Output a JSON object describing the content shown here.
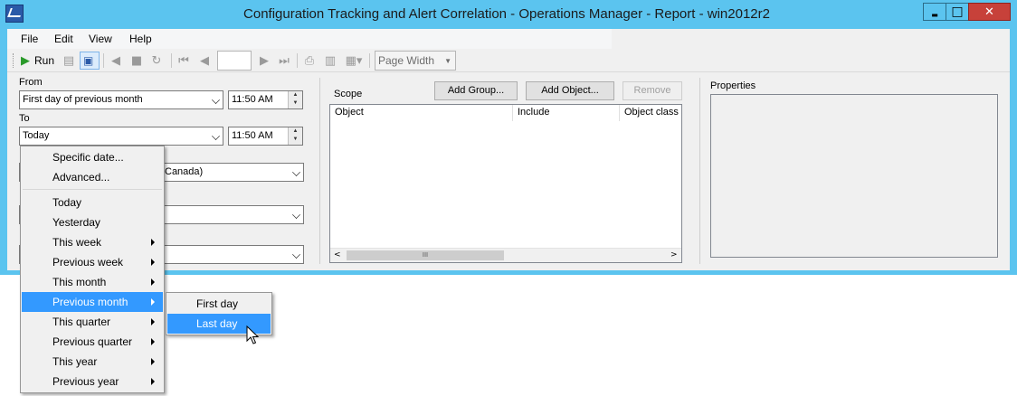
{
  "window": {
    "title": "Configuration Tracking and Alert Correlation - Operations Manager - Report - win2012r2",
    "controls": {
      "minimize": "▬",
      "maximize": "□",
      "close": "✕"
    }
  },
  "menu": {
    "items": [
      "File",
      "Edit",
      "View",
      "Help"
    ]
  },
  "toolbar": {
    "run_label": "Run",
    "zoom_value": "Page Width",
    "page_number": ""
  },
  "form": {
    "from_label": "From",
    "from_value": "First day of previous month",
    "from_time": "11:50 AM",
    "to_label": "To",
    "to_value": "Today",
    "to_time": "11:50 AM",
    "timezone_partial": "Canada)",
    "combo_a_value": "",
    "combo_b_value": ""
  },
  "scope": {
    "label": "Scope",
    "add_group": "Add Group...",
    "add_object": "Add Object...",
    "remove": "Remove",
    "columns": [
      "Object",
      "Include",
      "Object class"
    ],
    "scroll_thumb": "III"
  },
  "properties": {
    "label": "Properties"
  },
  "context_menu": {
    "items": [
      {
        "label": "Specific date...",
        "submenu": false
      },
      {
        "label": "Advanced...",
        "submenu": false
      },
      {
        "label": "Today",
        "submenu": false
      },
      {
        "label": "Yesterday",
        "submenu": false
      },
      {
        "label": "This week",
        "submenu": true
      },
      {
        "label": "Previous week",
        "submenu": true
      },
      {
        "label": "This month",
        "submenu": true
      },
      {
        "label": "Previous month",
        "submenu": true,
        "highlighted": true
      },
      {
        "label": "This quarter",
        "submenu": true
      },
      {
        "label": "Previous quarter",
        "submenu": true
      },
      {
        "label": "This year",
        "submenu": true
      },
      {
        "label": "Previous year",
        "submenu": true
      }
    ],
    "submenu": [
      {
        "label": "First day"
      },
      {
        "label": "Last day",
        "highlighted": true
      }
    ]
  },
  "colors": {
    "frame": "#5bc4ef",
    "highlight": "#3399ff",
    "close": "#c7413a"
  }
}
